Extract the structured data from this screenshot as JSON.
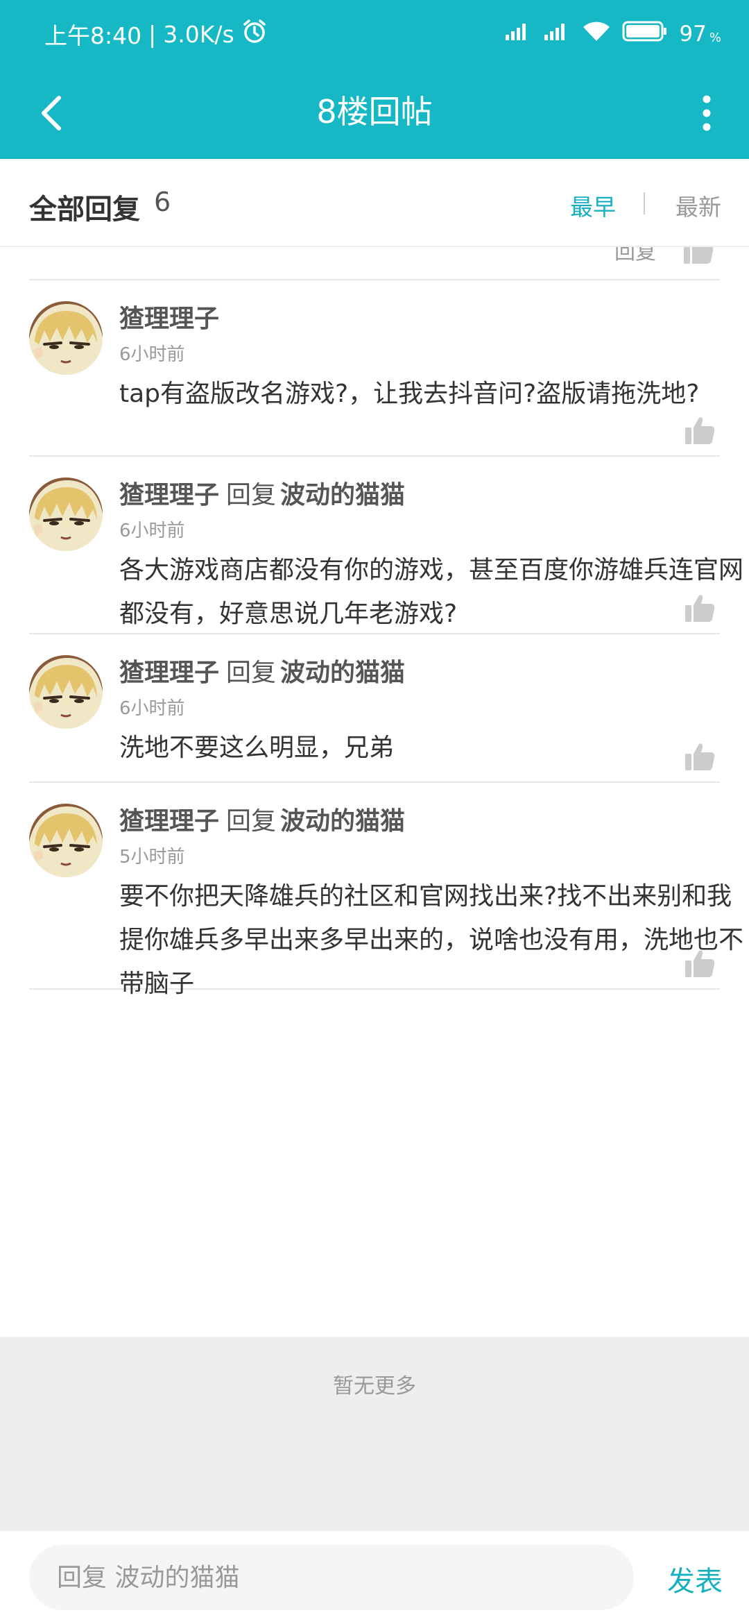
{
  "status_bar": {
    "time": "上午8:40",
    "separator": "|",
    "net_speed": "3.0K/s",
    "battery": "97",
    "battery_unit": "%"
  },
  "navbar": {
    "title": "8楼回帖",
    "back_icon": "back-arrow-icon",
    "more_icon": "more-vertical-icon"
  },
  "reply_header": {
    "title": "全部回复",
    "count": "6",
    "sort_earliest": "最早",
    "sort_newest": "最新"
  },
  "partial_item": {
    "text": "回复"
  },
  "replies": [
    {
      "author": "猹理理子",
      "reply_word": "",
      "target": "",
      "time": "6小时前",
      "content": "tap有盗版改名游戏?，让我去抖音问?盗版请拖洗地?"
    },
    {
      "author": "猹理理子",
      "reply_word": "回复",
      "target": "波动的猫猫",
      "time": "6小时前",
      "content": "各大游戏商店都没有你的游戏，甚至百度你游雄兵连官网都没有，好意思说几年老游戏?"
    },
    {
      "author": "猹理理子",
      "reply_word": "回复",
      "target": "波动的猫猫",
      "time": "6小时前",
      "content": "洗地不要这么明显，兄弟"
    },
    {
      "author": "猹理理子",
      "reply_word": "回复",
      "target": "波动的猫猫",
      "time": "5小时前",
      "content": "要不你把天降雄兵的社区和官网找出来?找不出来别和我提你雄兵多早出来多早出来的，说啥也没有用，洗地也不带脑子"
    }
  ],
  "footer": {
    "no_more": "暂无更多"
  },
  "bottom_bar": {
    "placeholder": "回复 波动的猫猫",
    "publish_label": "发表"
  },
  "colors": {
    "accent": "#16b8c6",
    "link": "#16b0bf"
  }
}
